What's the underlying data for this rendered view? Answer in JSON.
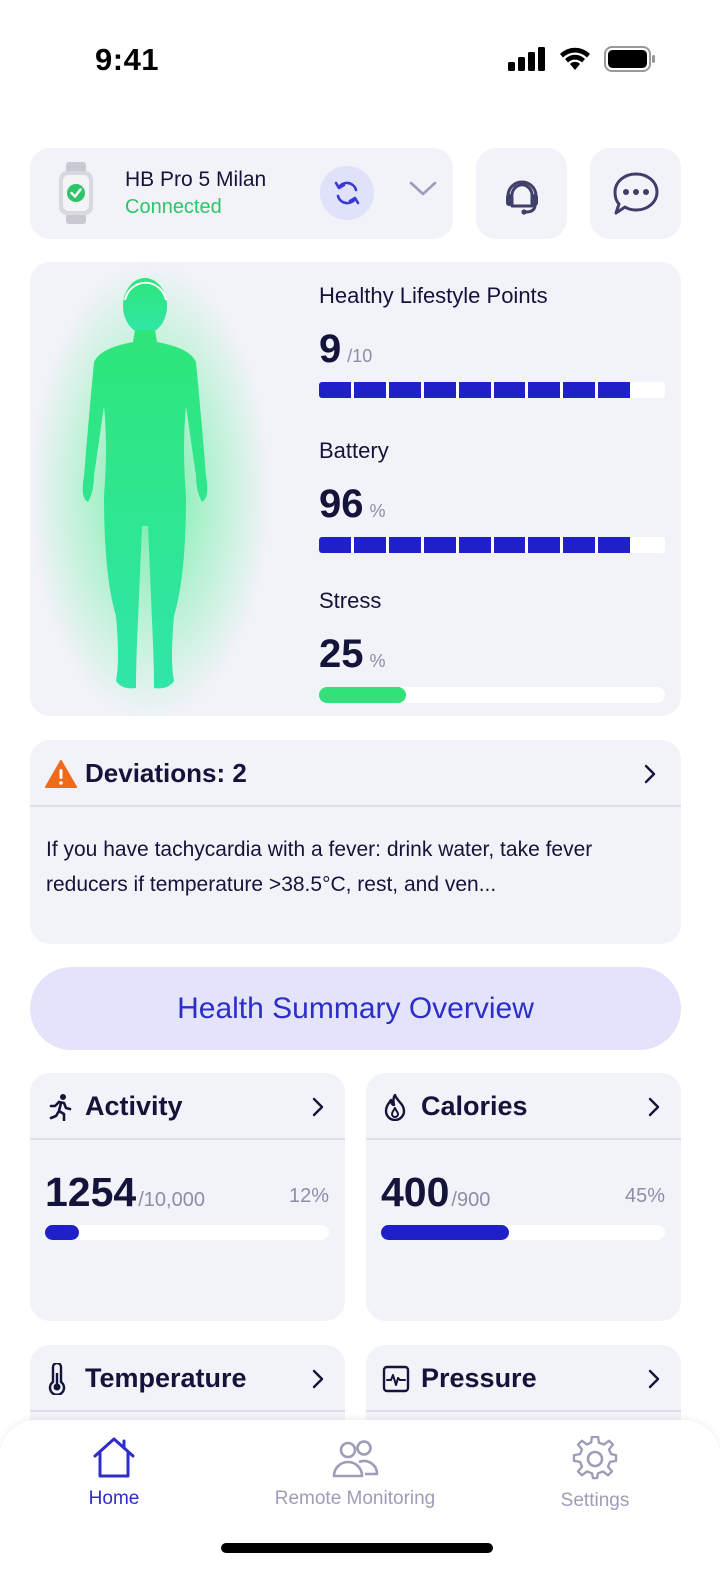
{
  "status_bar": {
    "time": "9:41"
  },
  "device": {
    "name": "HB Pro 5 Milan",
    "status": "Connected",
    "icons": {
      "watch": "watch-icon",
      "sync": "sync-icon",
      "expand": "chevron-down-icon",
      "support": "support-agent-icon",
      "chat": "chat-bubble-icon"
    }
  },
  "metrics": {
    "lifestyle": {
      "label": "Healthy Lifestyle Points",
      "value": "9",
      "unit": "/10",
      "level": 0.9
    },
    "battery": {
      "label": "Battery",
      "value": "96",
      "unit": "%",
      "level": 0.96
    },
    "stress": {
      "label": "Stress",
      "value": "25",
      "unit": "%",
      "level": 0.25
    }
  },
  "deviations": {
    "title": "Deviations: 2",
    "text": "If you have tachycardia with a fever: drink water, take fever reducers if temperature >38.5°C, rest, and ven..."
  },
  "summary_button": "Health Summary Overview",
  "tiles": {
    "activity": {
      "title": "Activity",
      "value": "1254",
      "goal": "/10,000",
      "percent": "12%",
      "level": 0.12
    },
    "calories": {
      "title": "Calories",
      "value": "400",
      "goal": "/900",
      "percent": "45%",
      "level": 0.45
    },
    "temperature": {
      "title": "Temperature"
    },
    "pressure": {
      "title": "Pressure"
    }
  },
  "nav": {
    "home": "Home",
    "remote": "Remote Monitoring",
    "settings": "Settings"
  },
  "colors": {
    "accent": "#2d2dc8",
    "bar_fill": "#2020c8",
    "connected": "#2ec46a",
    "stress": "#33e07a",
    "warning": "#f06a1a",
    "card_bg": "#f2f2f9"
  }
}
